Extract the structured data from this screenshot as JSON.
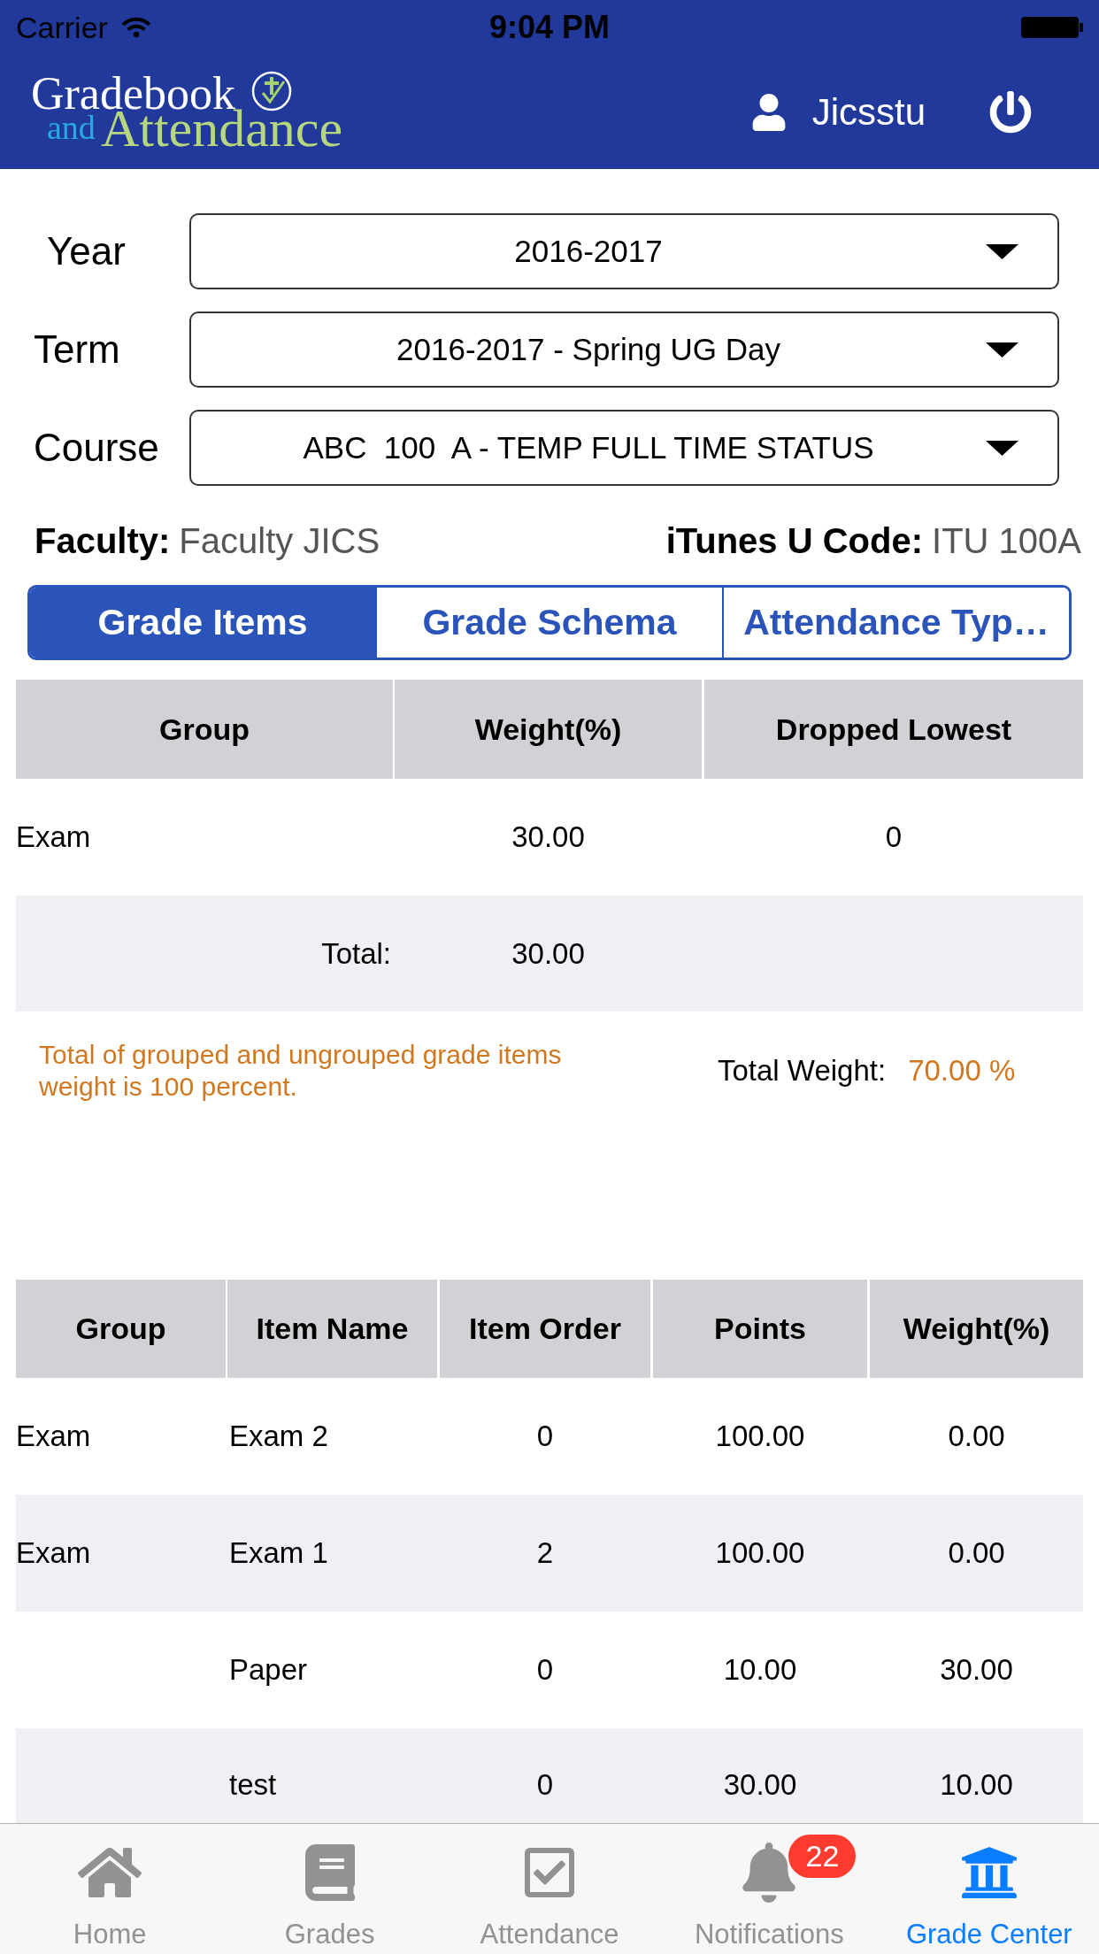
{
  "status_bar": {
    "carrier": "Carrier",
    "time": "9:04 PM"
  },
  "header": {
    "logo": {
      "line_1": "Gradebook",
      "line_2_small": "and",
      "line_2": "Attendance"
    },
    "user": "Jicsstu"
  },
  "filters": [
    {
      "label": "Year",
      "value": "2016-2017"
    },
    {
      "label": "Term",
      "value": "2016-2017 - Spring UG Day"
    },
    {
      "label": "Course",
      "value": "ABC  100  A - TEMP FULL TIME STATUS"
    }
  ],
  "info": [
    {
      "label": "Faculty:",
      "value": "Faculty JICS"
    },
    {
      "label": "iTunes U Code:",
      "value": "ITU 100A"
    }
  ],
  "tabs": [
    {
      "label": "Grade Items",
      "selected": true
    },
    {
      "label": "Grade Schema",
      "selected": false
    },
    {
      "label": "Attendance Typ…",
      "selected": false
    }
  ],
  "group_table": {
    "columns": [
      "Group",
      "Weight(%)",
      "Dropped Lowest"
    ],
    "rows": [
      {
        "group": "Exam",
        "weight": "30.00",
        "dropped_lowest": "0"
      }
    ],
    "total": {
      "label": "Total:",
      "weight": "30.00"
    }
  },
  "note": "Total of grouped and ungrouped grade items weight is 100 percent.",
  "total_weight": {
    "label": "Total Weight:",
    "value": "70.00 %"
  },
  "item_table": {
    "columns": [
      "Group",
      "Item Name",
      "Item Order",
      "Points",
      "Weight(%)"
    ],
    "rows": [
      {
        "group": "Exam",
        "item_name": "Exam 2",
        "item_order": "0",
        "points": "100.00",
        "weight": "0.00"
      },
      {
        "group": "Exam",
        "item_name": "Exam 1",
        "item_order": "2",
        "points": "100.00",
        "weight": "0.00"
      },
      {
        "item_name": "Paper",
        "item_order": "0",
        "points": "10.00",
        "weight": "30.00"
      },
      {
        "item_name": "test",
        "item_order": "0",
        "points": "30.00",
        "weight": "10.00"
      }
    ]
  },
  "tab_bar": [
    {
      "label": "Home",
      "selected": false
    },
    {
      "label": "Grades",
      "selected": false
    },
    {
      "label": "Attendance",
      "selected": false
    },
    {
      "label": "Notifications",
      "selected": false,
      "badge": "22"
    },
    {
      "label": "Grade Center",
      "selected": true
    }
  ]
}
